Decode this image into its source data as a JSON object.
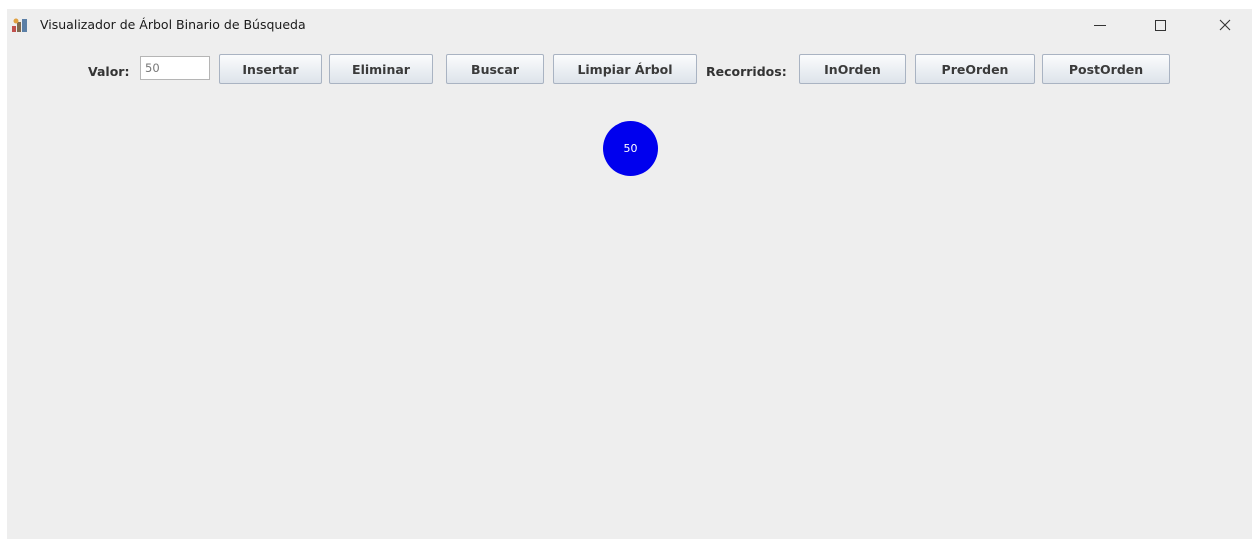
{
  "window": {
    "title": "Visualizador de Árbol Binario de Búsqueda",
    "controls": {
      "minimize": "—",
      "maximize": "☐",
      "close": "✕"
    }
  },
  "toolbar": {
    "value_label": "Valor:",
    "value_input": "50",
    "insert_label": "Insertar",
    "delete_label": "Eliminar",
    "search_label": "Buscar",
    "clear_label": "Limpiar Árbol",
    "traversals_label": "Recorridos:",
    "inorder_label": "InOrden",
    "preorder_label": "PreOrden",
    "postorder_label": "PostOrden"
  },
  "tree": {
    "nodes": [
      {
        "value": "50",
        "color": "#0000ee"
      }
    ]
  },
  "colors": {
    "background": "#eeeeee",
    "node": "#0000ee",
    "node_text": "#ffffff"
  }
}
